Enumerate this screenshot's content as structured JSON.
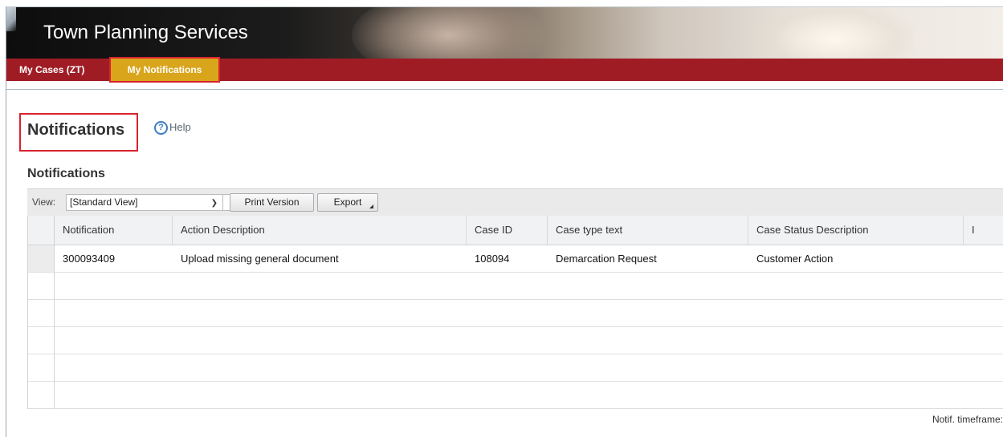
{
  "app": {
    "title": "Town Planning Services"
  },
  "nav": {
    "items": [
      {
        "label": "My Cases (ZT)"
      },
      {
        "label": "My Notifications"
      }
    ]
  },
  "page": {
    "title": "Notifications",
    "help_label": "Help"
  },
  "section": {
    "title": "Notifications"
  },
  "toolbar": {
    "view_label": "View:",
    "view_selected": "[Standard View]",
    "print_label": "Print Version",
    "export_label": "Export"
  },
  "table": {
    "columns": [
      "Notification",
      "Action Description",
      "Case ID",
      "Case type text",
      "Case Status Description",
      "I"
    ],
    "rows": [
      {
        "notification": "300093409",
        "action": "Upload missing general document",
        "case_id": "108094",
        "case_type": "Demarcation Request",
        "status": "Customer Action",
        "extra": ""
      }
    ]
  },
  "footer": {
    "timeframe_label": "Notif. timeframe:"
  },
  "colors": {
    "nav_bg": "#a01c25",
    "active_tab": "#d9a51b",
    "highlight_box": "#d9232e",
    "help_icon": "#3b7dc4"
  }
}
